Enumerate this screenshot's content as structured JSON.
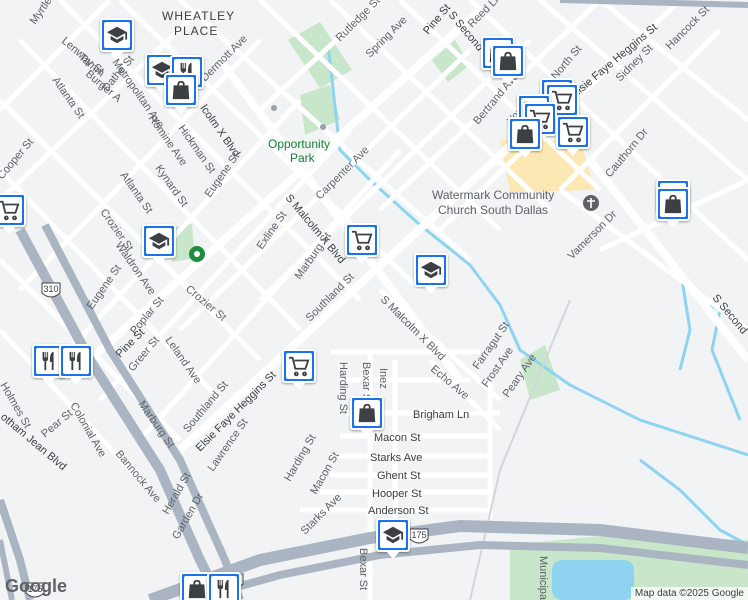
{
  "map": {
    "neighborhood": [
      "WHEATLEY",
      "PLACE"
    ],
    "park": [
      "Opportunity",
      "Park"
    ],
    "church": [
      "Watermark Community",
      "Church South Dallas"
    ],
    "attribution": "Map data ©2025 Google",
    "logo": "Google",
    "shields": [
      "310",
      "310",
      "175",
      "175"
    ],
    "streets": {
      "myrtle": "Myrtle St",
      "lenway": "Lenway St",
      "tamm": "Tamm",
      "burger": "Burger A",
      "dathe": "Dathe St",
      "rutledge": "Rutledge St",
      "spring": "Spring Ave",
      "pine_s": "Pine St",
      "s_second": "S Second",
      "reed": "Reed Ln",
      "elsie_top": "Elsie Faye Heggins St",
      "hancock": "Hancock St",
      "sidney": "Sidney St",
      "north": "North St",
      "bertrand": "Bertrand Ave",
      "york": "York St",
      "metropolitan": "Metropolitan Ave",
      "dermott": "Dermott Ave",
      "atlanta1": "Atlanta St",
      "atlanta2": "Atlanta St",
      "romine": "Romine Ave",
      "hickman": "Hickman St",
      "malcolm_top": "lcolm X Blvd",
      "kynard": "Kynard St",
      "eugene1": "Eugene St",
      "cooper": "Cooper St",
      "crozier1": "Crozier St",
      "crozier2": "Crozier St",
      "carpenter": "Carpenter Ave",
      "cauthorn": "Cauthorn Dr",
      "vamerson": "Vamerson Dr",
      "s_second_east": "S Second",
      "waldron": "Waldron Ave",
      "exline": "Exline St",
      "s_malcolm": "S Malcolm X Blvd",
      "marburg1": "Marburg St",
      "eugene2": "Eugene St",
      "poplar": "Poplar St",
      "pine_w": "Pine St",
      "southland1": "Southland St",
      "s_malcolm_2": "S Malcolm X Blvd",
      "leland": "Leland Ave",
      "greer": "Greer St",
      "farragut": "Farragut St",
      "frost": "Frost Ave",
      "peary": "Peary Ave",
      "echo": "Echo Ave",
      "holmes": "Holmes St",
      "colonial": "Colonial Ave",
      "marburg2": "Marburg St",
      "southland2": "Southland St",
      "harding1": "Harding St",
      "bexar1": "Bexar St",
      "inez": "Inez",
      "elsie_low": "Elsie Faye Heggins St",
      "brigham": "Brigham Ln",
      "pear": "Pear St",
      "botham": "otham Jean Blvd",
      "bannock": "Bannock Ave",
      "lawrence": "Lawrence St",
      "macon1": "Macon St",
      "starks1": "Starks Ave",
      "harding2": "Harding St",
      "ghent": "Ghent St",
      "macon2": "Macon St",
      "hooper": "Hooper St",
      "herald": "Herald St",
      "starks2": "Starks Ave",
      "anderson": "Anderson St",
      "garden": "Garden Dr",
      "bexar2": "Bexar St",
      "municipal": "Municipal"
    }
  },
  "markers": [
    {
      "icon": "school-icon"
    },
    {
      "icon": "school-icon"
    },
    {
      "icon": "restaurant-icon"
    },
    {
      "icon": "shopping-bag-icon"
    },
    {
      "icon": "shopping-bag-icon"
    },
    {
      "icon": "shopping-bag-icon"
    },
    {
      "icon": "shopping-bag-icon"
    },
    {
      "icon": "shopping-cart-icon"
    },
    {
      "icon": "shopping-cart-icon"
    },
    {
      "icon": "shopping-cart-icon"
    },
    {
      "icon": "school-icon"
    },
    {
      "icon": "shopping-cart-icon"
    },
    {
      "icon": "shopping-bag-icon"
    },
    {
      "icon": "shopping-cart-icon"
    },
    {
      "icon": "school-icon"
    },
    {
      "icon": "restaurant-icon"
    },
    {
      "icon": "shopping-cart-icon"
    },
    {
      "icon": "shopping-bag-icon"
    },
    {
      "icon": "school-icon"
    },
    {
      "icon": "shopping-bag-icon"
    },
    {
      "icon": "restaurant-icon"
    }
  ],
  "colors": {
    "marker": "#1a73e8",
    "water": "#8ed4f0",
    "park": "#c8e6c9",
    "highway": "#aab4c3",
    "road": "#ffffff",
    "land": "#f1f3f4"
  }
}
